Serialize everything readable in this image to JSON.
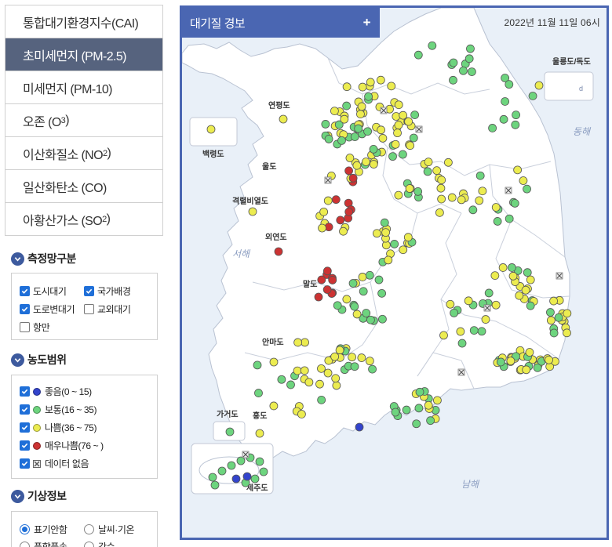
{
  "nav": {
    "items": [
      {
        "label": "통합대기환경지수(CAI)",
        "active": false
      },
      {
        "label": "초미세먼지 (PM-2.5)",
        "active": true
      },
      {
        "label": "미세먼지 (PM-10)",
        "active": false
      },
      {
        "label": "오존 (O",
        "sub": "3",
        "suffix": ")",
        "active": false
      },
      {
        "label": "이산화질소 (NO",
        "sub": "2",
        "suffix": ")",
        "active": false
      },
      {
        "label": "일산화탄소 (CO)",
        "active": false
      },
      {
        "label": "아황산가스 (SO",
        "sub": "2",
        "suffix": ")",
        "active": false
      }
    ]
  },
  "network": {
    "title": "측정망구분",
    "options": [
      {
        "label": "도시대기",
        "checked": true
      },
      {
        "label": "국가배경",
        "checked": true
      },
      {
        "label": "도로변대기",
        "checked": true
      },
      {
        "label": "교외대기",
        "checked": false
      },
      {
        "label": "항만",
        "checked": false
      }
    ]
  },
  "range": {
    "title": "농도범위",
    "legend": [
      {
        "label": "좋음(0 ~ 15)",
        "color": "#3344cc",
        "checked": true
      },
      {
        "label": "보통(16 ~ 35)",
        "color": "#6dd47e",
        "checked": true
      },
      {
        "label": "나쁨(36 ~ 75)",
        "color": "#ecec50",
        "checked": true
      },
      {
        "label": "매우나쁨(76 ~ )",
        "color": "#cc3333",
        "checked": true
      },
      {
        "label": "데이터 없음",
        "icon": "no-data-icon",
        "checked": true
      }
    ]
  },
  "weather": {
    "title": "기상정보",
    "options": [
      {
        "label": "표기안함",
        "selected": true
      },
      {
        "label": "날씨·기온",
        "selected": false
      },
      {
        "label": "풍향풍속",
        "selected": false
      },
      {
        "label": "강수",
        "selected": false
      }
    ]
  },
  "map": {
    "title": "대기질 경보",
    "plus_label": "+",
    "date": "2022년 11월 11일 06시",
    "labels": {
      "ulleung": "울릉도/독도",
      "dokdo": "d",
      "baengnyeong": "백령도",
      "yeonpyeong": "연평도",
      "uldo": "울도",
      "gyeokryeol": "격렬비열도",
      "oeyeon": "외연도",
      "maldo": "말도",
      "anmado": "안마도",
      "gageo": "가거도",
      "hongdo": "홍도",
      "jeju": "제주도",
      "east_sea": "동해",
      "west_sea": "서해",
      "south_sea": "남해"
    },
    "colors": {
      "good": "#3344cc",
      "normal": "#6dd47e",
      "bad": "#ecec50",
      "very_bad": "#cc3333",
      "land": "#ffffff",
      "sea": "#e9f0f8",
      "border": "#c3c9d6"
    }
  }
}
